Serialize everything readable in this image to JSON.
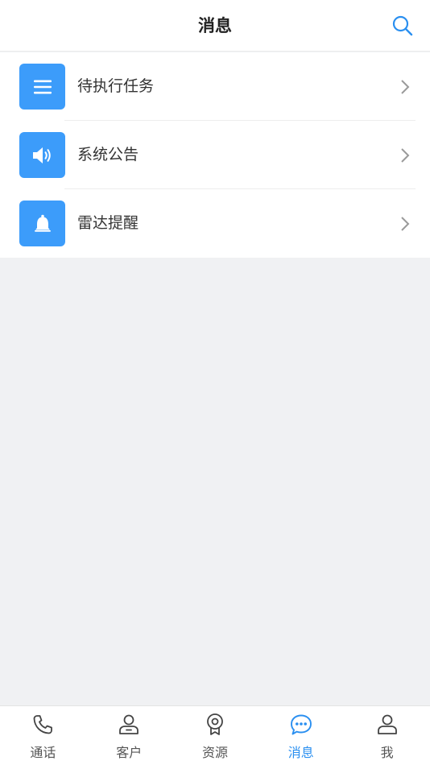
{
  "header": {
    "title": "消息",
    "search_icon": "search-icon"
  },
  "messages": [
    {
      "label": "待执行任务",
      "icon": "list-icon"
    },
    {
      "label": "系统公告",
      "icon": "speaker-icon"
    },
    {
      "label": "雷达提醒",
      "icon": "bell-icon"
    }
  ],
  "tabbar": {
    "active": "消息",
    "tabs": [
      {
        "label": "通话",
        "icon": "phone-icon"
      },
      {
        "label": "客户",
        "icon": "customer-icon"
      },
      {
        "label": "资源",
        "icon": "resource-icon"
      },
      {
        "label": "消息",
        "icon": "chat-icon"
      },
      {
        "label": "我",
        "icon": "user-icon"
      }
    ]
  },
  "colors": {
    "accent": "#2a8ff0",
    "icon_tile": "#3c9cfa",
    "background": "#f0f1f3",
    "inactive": "#555555"
  }
}
